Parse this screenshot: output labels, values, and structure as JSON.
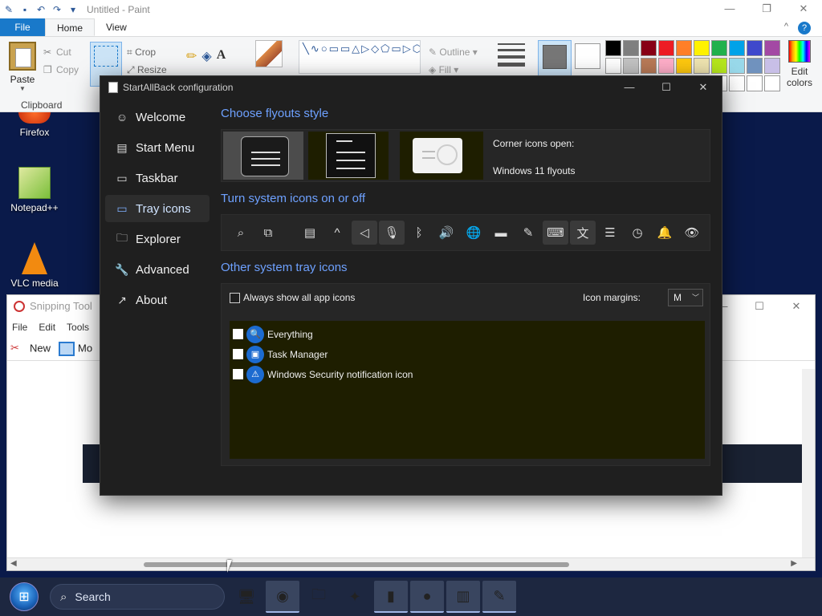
{
  "paint": {
    "title": "Untitled - Paint",
    "tabs": [
      "File",
      "Home",
      "View"
    ],
    "clipboard": {
      "paste": "Paste",
      "cut": "Cut",
      "copy": "Copy",
      "group": "Clipboard"
    },
    "image": {
      "crop": "Crop",
      "resize": "Resize"
    },
    "shapes": {
      "outline": "Outline",
      "fill": "Fill"
    },
    "edit_colors": "Edit colors",
    "palette_colors": [
      "#000000",
      "#7f7f7f",
      "#880015",
      "#ed1c24",
      "#ff7f27",
      "#fff200",
      "#22b14c",
      "#00a2e8",
      "#3f48cc",
      "#a349a4",
      "#ffffff",
      "#c3c3c3",
      "#b97a57",
      "#ffaec9",
      "#ffc90e",
      "#efe4b0",
      "#b5e61d",
      "#99d9ea",
      "#7092be",
      "#c8bfe7",
      "#ffffff",
      "#ffffff",
      "#ffffff",
      "#ffffff",
      "#ffffff",
      "#ffffff",
      "#ffffff",
      "#ffffff",
      "#ffffff",
      "#ffffff"
    ]
  },
  "desktop": {
    "icons": [
      {
        "label": "Firefox",
        "icon": "firefox-icon"
      },
      {
        "label": "Notepad++",
        "icon": "notepadpp-icon"
      },
      {
        "label": "VLC media",
        "icon": "vlc-icon"
      }
    ]
  },
  "snipping": {
    "title": "Snipping Tool",
    "menu": [
      "File",
      "Edit",
      "Tools"
    ],
    "new": "New",
    "mode": "Mo"
  },
  "sab": {
    "title": "StartAllBack configuration",
    "nav": [
      {
        "label": "Welcome",
        "icon": "smile-icon",
        "glyph": "☺"
      },
      {
        "label": "Start Menu",
        "icon": "start-menu-icon",
        "glyph": "▤"
      },
      {
        "label": "Taskbar",
        "icon": "taskbar-icon",
        "glyph": "▭"
      },
      {
        "label": "Tray icons",
        "icon": "tray-icon",
        "glyph": "▭",
        "active": true
      },
      {
        "label": "Explorer",
        "icon": "folder-icon",
        "glyph": "🗀"
      },
      {
        "label": "Advanced",
        "icon": "wrench-icon",
        "glyph": "🔧"
      },
      {
        "label": "About",
        "icon": "about-icon",
        "glyph": "↗"
      }
    ],
    "flyouts": {
      "title": "Choose flyouts style",
      "corner_label": "Corner icons open:",
      "corner_value": "Windows 11 flyouts"
    },
    "system_icons": {
      "title": "Turn system icons on or off",
      "icons": [
        {
          "name": "search-icon",
          "glyph": "⌕",
          "on": false
        },
        {
          "name": "task-view-icon",
          "glyph": "⧉",
          "on": false
        },
        {
          "name": "news-icon",
          "glyph": "▤",
          "on": false
        },
        {
          "name": "chevron-up-icon",
          "glyph": "^",
          "on": false
        },
        {
          "name": "location-icon",
          "glyph": "◁",
          "on": true
        },
        {
          "name": "microphone-icon",
          "glyph": "🎙",
          "on": true
        },
        {
          "name": "bluetooth-icon",
          "glyph": "ᛒ",
          "on": false
        },
        {
          "name": "volume-icon",
          "glyph": "🔊",
          "on": false
        },
        {
          "name": "network-icon",
          "glyph": "🌐",
          "on": false
        },
        {
          "name": "battery-icon",
          "glyph": "▬",
          "on": false
        },
        {
          "name": "pen-icon",
          "glyph": "✎",
          "on": false
        },
        {
          "name": "keyboard-icon",
          "glyph": "⌨",
          "on": true
        },
        {
          "name": "language-icon",
          "glyph": "文",
          "on": true
        },
        {
          "name": "mixer-icon",
          "glyph": "☰",
          "on": false
        },
        {
          "name": "clock-icon",
          "glyph": "◷",
          "on": false
        },
        {
          "name": "bell-icon",
          "glyph": "🔔",
          "on": false
        },
        {
          "name": "eye-icon",
          "glyph": "👁",
          "on": false
        }
      ]
    },
    "other": {
      "title": "Other system tray icons",
      "always_show": "Always show all app icons",
      "margin_label": "Icon margins:",
      "margin_value": "M",
      "apps": [
        {
          "label": "Everything",
          "icon": "everything-icon",
          "glyph": "🔍"
        },
        {
          "label": "Task Manager",
          "icon": "task-manager-icon",
          "glyph": "▣"
        },
        {
          "label": "Windows Security notification icon",
          "icon": "security-icon",
          "glyph": "⚠"
        }
      ]
    }
  },
  "taskbar": {
    "search_placeholder": "Search",
    "apps": [
      {
        "name": "monitor-app",
        "glyph": "🖥",
        "running": false
      },
      {
        "name": "firefox-app",
        "glyph": "◉",
        "running": true
      },
      {
        "name": "explorer-app",
        "glyph": "🗀",
        "running": false
      },
      {
        "name": "paint-app-alt",
        "glyph": "✦",
        "running": false
      },
      {
        "name": "startallback-app",
        "glyph": "▮",
        "running": true
      },
      {
        "name": "record-app",
        "glyph": "●",
        "running": true
      },
      {
        "name": "book-app",
        "glyph": "▥",
        "running": true
      },
      {
        "name": "paint-app",
        "glyph": "✎",
        "running": true
      }
    ]
  }
}
